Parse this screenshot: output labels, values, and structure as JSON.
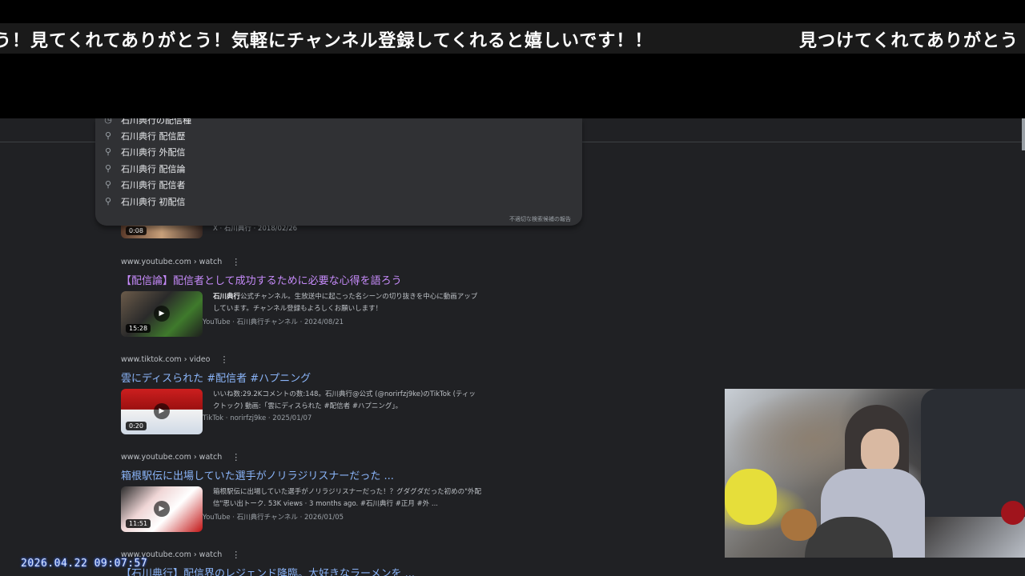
{
  "ticker": {
    "text_a": "う！見てくれてありがとう！気軽にチャンネル登録してくれると嬉しいです！！",
    "text_b": "見つけてくれてありがとう"
  },
  "suggestions": {
    "items": [
      "石川典行の配信種",
      "石川典行 配信歴",
      "石川典行 外配信",
      "石川典行 配信論",
      "石川典行 配信者",
      "石川典行 初配信"
    ],
    "report_link": "不適切な検索候補の報告"
  },
  "partial_result": {
    "duration": "0:08",
    "meta": "X · 石川典行 · 2018/02/26"
  },
  "results": [
    {
      "cite": "www.youtube.com › watch",
      "title": "【配信論】配信者として成功するために必要な心得を語ろう",
      "duration": "15:28",
      "snippet_bold": "石川典行",
      "snippet": "公式チャンネル。生放送中に起こった名シーンの切り抜きを中心に動画アップしています。チャンネル登録もよろしくお願いします！",
      "meta": "YouTube · 石川典行チャンネル · 2024/08/21"
    },
    {
      "cite": "www.tiktok.com › video",
      "title": "雲にディスられた #配信者 #ハプニング",
      "duration": "0:20",
      "snippet": "いいね数:29.2Kコメントの数:148。石川典行@公式 (@norirfzj9ke)のTikTok (ティックトック) 動画:「雲にディスられた #配信者 #ハプニング」。",
      "meta": "TikTok · norirfzj9ke · 2025/01/07"
    },
    {
      "cite": "www.youtube.com › watch",
      "title": "箱根駅伝に出場していた選手がノリラジリスナーだった ...",
      "duration": "11:51",
      "snippet": "箱根駅伝に出場していた選手がノリラジリスナーだった！？グダグダだった初めの\"外配信\"思い出トーク. 53K views · 3 months ago. #石川典行 #正月 #外 ...",
      "meta": "YouTube · 石川典行チャンネル · 2026/01/05"
    },
    {
      "cite": "www.youtube.com › watch",
      "title": "【石川典行】配信界のレジェンド降臨。大好きなラーメンを ..."
    }
  ],
  "timestamp": "2026.04.22  09:07:57"
}
